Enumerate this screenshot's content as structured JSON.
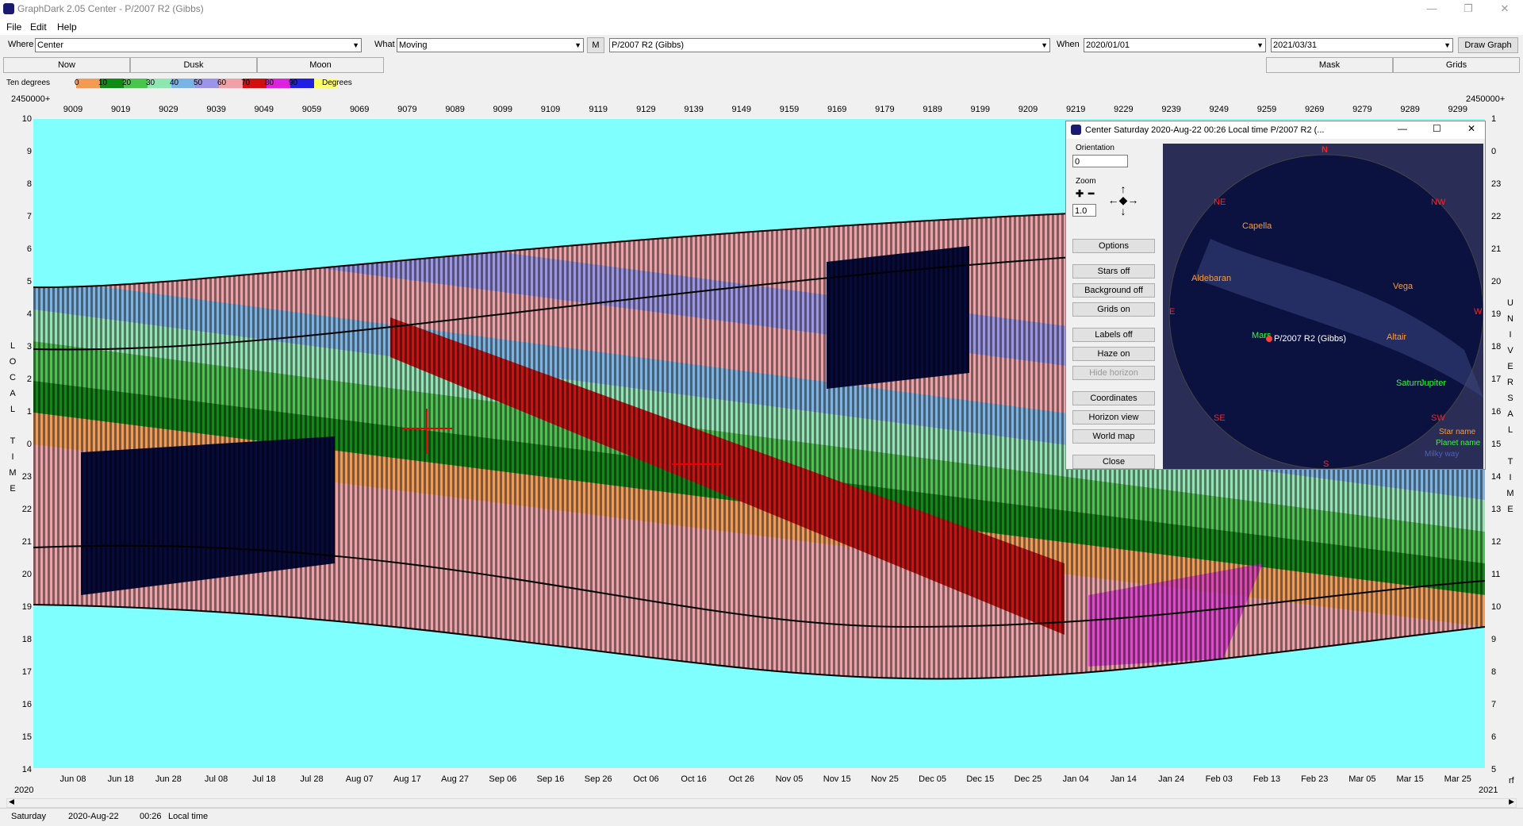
{
  "window": {
    "title": "GraphDark 2.05  Center  -  P/2007 R2 (Gibbs)"
  },
  "menu": [
    "File",
    "Edit",
    "Help"
  ],
  "toolbar": {
    "where_label": "Where",
    "where_value": "Center",
    "what_label": "What",
    "what_value": "Moving",
    "m_button": "M",
    "object_value": "P/2007 R2 (Gibbs)",
    "when_label": "When",
    "when_start": "2020/01/01",
    "when_end": "2021/03/31",
    "draw_button": "Draw Graph"
  },
  "tabs": [
    "Now",
    "Dusk",
    "Moon",
    "Mask",
    "Grids"
  ],
  "legend": {
    "label": "Ten degrees",
    "unit": "Degrees",
    "ticks": [
      "0",
      "10",
      "20",
      "30",
      "40",
      "50",
      "60",
      "70",
      "80",
      "90"
    ],
    "colors": [
      "#f59a53",
      "#0f8a14",
      "#49c44d",
      "#8ee6b1",
      "#7ab3e6",
      "#9b94e8",
      "#f2a0a8",
      "#d01010",
      "#e020e0",
      "#2020e0",
      "#ffff66"
    ]
  },
  "axes": {
    "top_left": "2450000+",
    "top_right": "2450000+",
    "jd_ticks": [
      "9009",
      "9019",
      "9029",
      "9039",
      "9049",
      "9059",
      "9069",
      "9079",
      "9089",
      "9099",
      "9109",
      "9119",
      "9129",
      "9139",
      "9149",
      "9159",
      "9169",
      "9179",
      "9189",
      "9199",
      "9209",
      "9219",
      "9229",
      "9239",
      "9249",
      "9259",
      "9269",
      "9279",
      "9289",
      "9299"
    ],
    "date_ticks": [
      "Jun 08",
      "Jun 18",
      "Jun 28",
      "Jul 08",
      "Jul 18",
      "Jul 28",
      "Aug 07",
      "Aug 17",
      "Aug 27",
      "Sep 06",
      "Sep 16",
      "Sep 26",
      "Oct 06",
      "Oct 16",
      "Oct 26",
      "Nov 05",
      "Nov 15",
      "Nov 25",
      "Dec 05",
      "Dec 15",
      "Dec 25",
      "Jan 04",
      "Jan 14",
      "Jan 24",
      "Feb 03",
      "Feb 13",
      "Feb 23",
      "Mar 05",
      "Mar 15",
      "Mar 25"
    ],
    "left_hours": [
      "10",
      "9",
      "8",
      "7",
      "6",
      "5",
      "4",
      "3",
      "2",
      "1",
      "0",
      "23",
      "22",
      "21",
      "20",
      "19",
      "18",
      "17",
      "16",
      "15",
      "14"
    ],
    "right_hours": [
      "1",
      "0",
      "23",
      "22",
      "21",
      "20",
      "19",
      "18",
      "17",
      "16",
      "15",
      "14",
      "13",
      "12",
      "11",
      "10",
      "9",
      "8",
      "7",
      "6",
      "5"
    ],
    "left_vertical": [
      "L",
      "O",
      "C",
      "A",
      "L",
      "",
      "T",
      "I",
      "M",
      "E"
    ],
    "right_vertical": [
      "U",
      "N",
      "I",
      "V",
      "E",
      "R",
      "S",
      "A",
      "L",
      "",
      "T",
      "I",
      "M",
      "E"
    ],
    "year_left": "2020",
    "year_right": "2021",
    "corner_right": "rf"
  },
  "sky": {
    "title": "Center    Saturday  2020-Aug-22   00:26 Local time        P/2007 R2 (...",
    "orientation_label": "Orientation",
    "orientation_value": "0",
    "zoom_label": "Zoom",
    "zoom_value": "1.0",
    "buttons": [
      "Options",
      "Stars off",
      "Background off",
      "Grids on",
      "Labels off",
      "Haze on",
      "Hide horizon",
      "Coordinates",
      "Horizon view",
      "World map",
      "Close"
    ],
    "compass": {
      "N": "N",
      "NE": "NE",
      "NW": "NW",
      "E": "E",
      "W": "W",
      "SE": "SE",
      "SW": "SW",
      "S": "S"
    },
    "stars": [
      "Capella",
      "Aldebaran",
      "Vega",
      "Altair",
      "Saturn",
      "Jupiter",
      "Mars"
    ],
    "comet": "P/2007 R2 (Gibbs)",
    "key": [
      "Star name",
      "Planet name",
      "Milky way"
    ]
  },
  "status": {
    "day": "Saturday",
    "date": "2020-Aug-22",
    "time": "00:26",
    "label": "Local time"
  }
}
